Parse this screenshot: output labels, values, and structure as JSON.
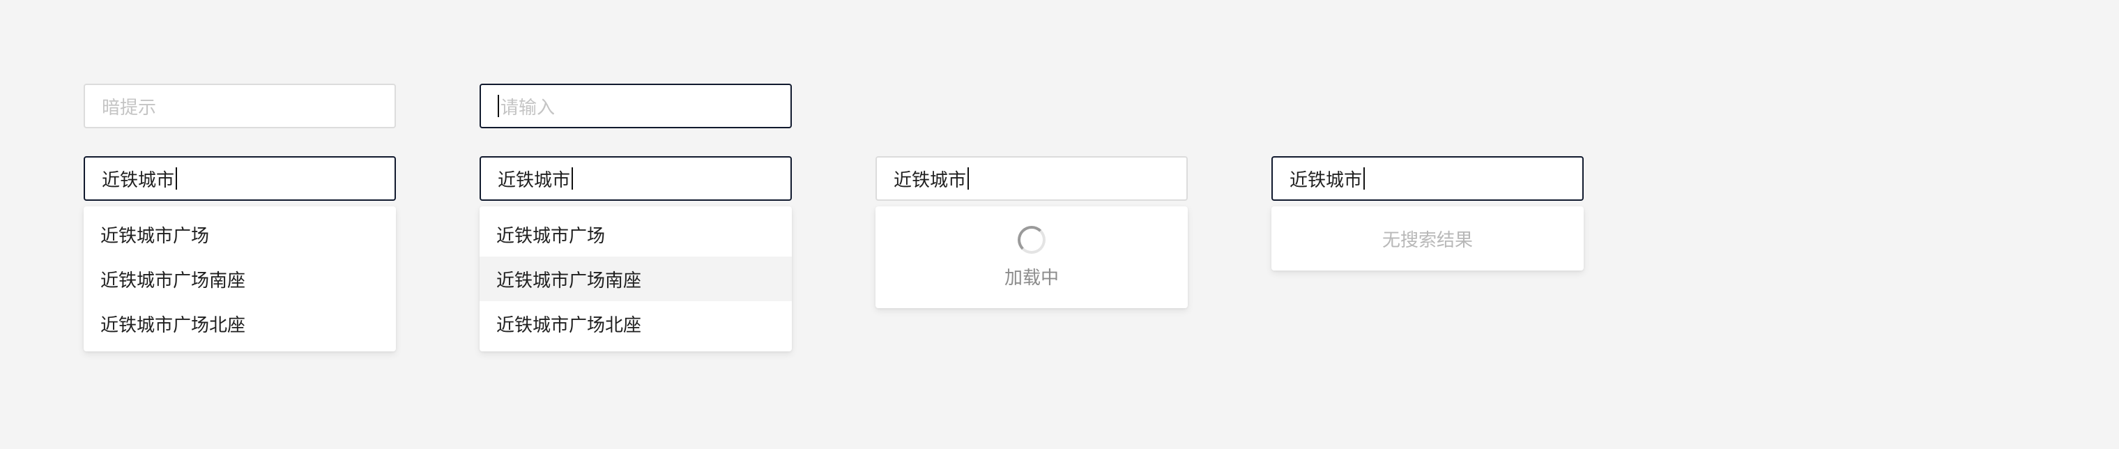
{
  "placeholder_field": {
    "placeholder": "暗提示"
  },
  "focused_empty_field": {
    "placeholder": "请输入"
  },
  "search_value": "近铁城市",
  "suggestions_col1": [
    "近铁城市广场",
    "近铁城市广场南座",
    "近铁城市广场北座"
  ],
  "suggestions_col2": [
    "近铁城市广场",
    "近铁城市广场南座",
    "近铁城市广场北座"
  ],
  "loading_text": "加载中",
  "empty_text": "无搜索结果",
  "colors": {
    "background": "#f4f4f4",
    "focus_border": "#111a2e",
    "hover_row": "#f3f3f3"
  }
}
